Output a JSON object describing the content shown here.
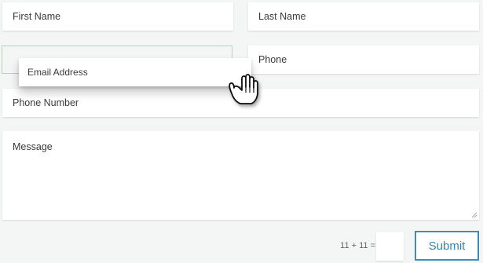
{
  "form": {
    "first_name": "First Name",
    "last_name": "Last Name",
    "email_address": "Email Address",
    "phone": "Phone",
    "phone_number": "Phone Number",
    "message": "Message",
    "captcha_question": "11 + 11 =",
    "captcha_value": "",
    "submit_label": "Submit"
  },
  "colors": {
    "accent": "#2f86bd",
    "drop_outline": "#b8d0c4",
    "background": "#f4f6f6"
  },
  "icons": {
    "cursor": "grab-hand-icon",
    "resize": "resize-grip-icon"
  }
}
